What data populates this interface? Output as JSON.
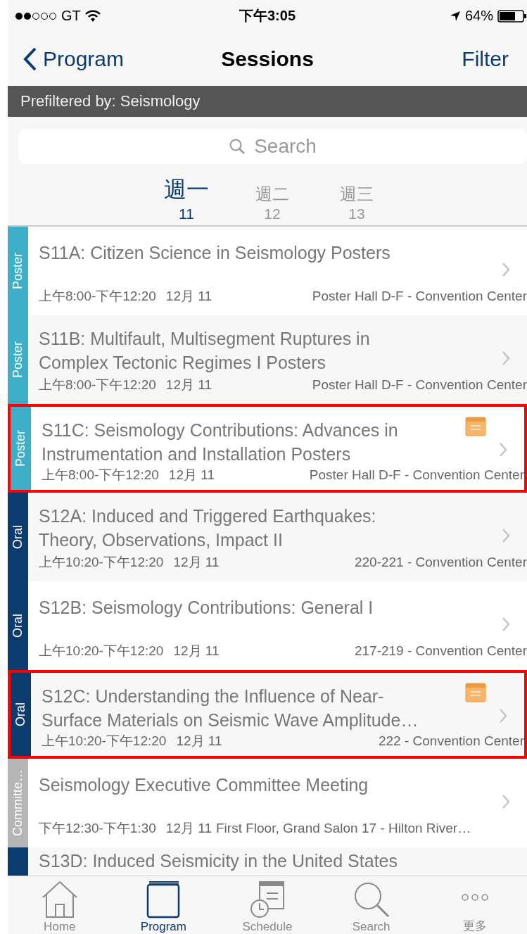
{
  "status_bar": {
    "carrier": "GT",
    "time": "下午3:05",
    "battery": "64%"
  },
  "nav": {
    "back": "Program",
    "title": "Sessions",
    "action": "Filter"
  },
  "filter_banner": "Prefiltered by: Seismology",
  "search": {
    "placeholder": "Search"
  },
  "days": [
    {
      "label": "週一",
      "date": "11",
      "selected": true
    },
    {
      "label": "週二",
      "date": "12",
      "selected": false
    },
    {
      "label": "週三",
      "date": "13",
      "selected": false
    }
  ],
  "sessions": [
    {
      "kind": "poster",
      "tag": "Poster",
      "title": "S11A: Citizen Science in Seismology Posters",
      "time": "上午8:00-下午12:20",
      "date": "12月 11",
      "location": "Poster Hall D-F - Convention Center",
      "scheduled": false,
      "highlighted": false
    },
    {
      "kind": "poster",
      "tag": "Poster",
      "title": "S11B: Multifault, Multisegment Ruptures in\nComplex Tectonic Regimes I Posters",
      "time": "上午8:00-下午12:20",
      "date": "12月 11",
      "location": "Poster Hall D-F - Convention Center",
      "scheduled": false,
      "highlighted": false
    },
    {
      "kind": "poster",
      "tag": "Poster",
      "title": "S11C: Seismology Contributions: Advances in\nInstrumentation and Installation Posters",
      "time": "上午8:00-下午12:20",
      "date": "12月 11",
      "location": "Poster Hall D-F - Convention Center",
      "scheduled": true,
      "highlighted": true
    },
    {
      "kind": "oral",
      "tag": "Oral",
      "title": "S12A: Induced and Triggered Earthquakes:\nTheory, Observations, Impact II",
      "time": "上午10:20-下午12:20",
      "date": "12月 11",
      "location": "220-221 - Convention Center",
      "scheduled": false,
      "highlighted": false
    },
    {
      "kind": "oral",
      "tag": "Oral",
      "title": "S12B: Seismology Contributions: General I",
      "time": "上午10:20-下午12:20",
      "date": "12月 11",
      "location": "217-219 - Convention Center",
      "scheduled": false,
      "highlighted": false
    },
    {
      "kind": "oral",
      "tag": "Oral",
      "title": "S12C: Understanding the Influence of Near-\nSurface Materials on Seismic Wave Amplitude…",
      "time": "上午10:20-下午12:20",
      "date": "12月 11",
      "location": "222 - Convention Center",
      "scheduled": true,
      "highlighted": true
    },
    {
      "kind": "committee",
      "tag": "Committe…",
      "title": "Seismology Executive Committee Meeting",
      "time": "下午12:30-下午1:30",
      "date": "12月 11",
      "location": "First Floor, Grand Salon 17 - Hilton River…",
      "scheduled": false,
      "highlighted": false
    },
    {
      "kind": "oral",
      "title": "S13D: Induced Seismicity in the United States",
      "partial": true,
      "scheduled": false,
      "highlighted": false
    }
  ],
  "tab_bar": [
    {
      "kind": "home",
      "label": "Home",
      "selected": false
    },
    {
      "kind": "program",
      "label": "Program",
      "selected": true
    },
    {
      "kind": "schedule",
      "label": "Schedule",
      "selected": false
    },
    {
      "kind": "search",
      "label": "Search",
      "selected": false
    },
    {
      "kind": "more",
      "label": "更多",
      "selected": false
    }
  ]
}
